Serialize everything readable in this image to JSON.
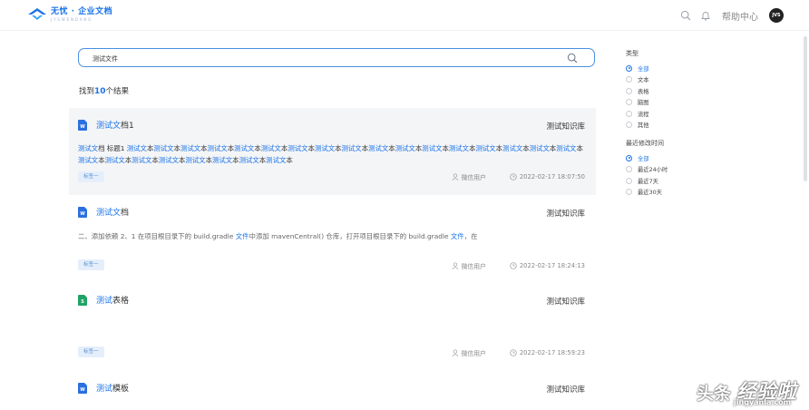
{
  "header": {
    "logo_title": "无忧 · 企业文档",
    "logo_subtitle": "J Y S W E N D A N G",
    "help_label": "帮助中心",
    "avatar_text": "JVS"
  },
  "search": {
    "value": "测试文件"
  },
  "results": {
    "prefix": "找到",
    "count": "10",
    "suffix": "个结果"
  },
  "cards": [
    {
      "title_hl": "测试文",
      "title_rest": "档1",
      "library": "测试知识库",
      "snippet_segments": [
        {
          "t": "测试文",
          "hl": true
        },
        {
          "t": "档 标题1 ",
          "hl": false
        },
        {
          "t": "测试文",
          "hl": true
        },
        {
          "t": "本",
          "hl": false
        },
        {
          "t": "测试文",
          "hl": true
        },
        {
          "t": "本",
          "hl": false
        },
        {
          "t": "测试文",
          "hl": true
        },
        {
          "t": "本",
          "hl": false
        },
        {
          "t": "测试文",
          "hl": true
        },
        {
          "t": "本",
          "hl": false
        },
        {
          "t": "测试文",
          "hl": true
        },
        {
          "t": "本",
          "hl": false
        },
        {
          "t": "测试文",
          "hl": true
        },
        {
          "t": "本",
          "hl": false
        },
        {
          "t": "测试文",
          "hl": true
        },
        {
          "t": "本",
          "hl": false
        },
        {
          "t": "测试文",
          "hl": true
        },
        {
          "t": "本",
          "hl": false
        },
        {
          "t": "测试文",
          "hl": true
        },
        {
          "t": "本",
          "hl": false
        },
        {
          "t": "测试文",
          "hl": true
        },
        {
          "t": "本",
          "hl": false
        },
        {
          "t": "测试文",
          "hl": true
        },
        {
          "t": "本",
          "hl": false
        },
        {
          "t": "测试文",
          "hl": true
        },
        {
          "t": "本",
          "hl": false
        },
        {
          "t": "测试文",
          "hl": true
        },
        {
          "t": "本",
          "hl": false
        },
        {
          "t": "测试文",
          "hl": true
        },
        {
          "t": "本",
          "hl": false
        },
        {
          "t": "测试文",
          "hl": true
        },
        {
          "t": "本",
          "hl": false
        },
        {
          "t": "测试文",
          "hl": true
        },
        {
          "t": "本",
          "hl": false
        },
        {
          "t": "测试文",
          "hl": true
        },
        {
          "t": "本",
          "hl": false
        },
        {
          "t": "测",
          "hl": true
        },
        {
          "t": "试文",
          "hl": true
        },
        {
          "t": "本",
          "hl": false
        },
        {
          "t": "测试文",
          "hl": true
        },
        {
          "t": "本",
          "hl": false
        },
        {
          "t": "测试文",
          "hl": true
        },
        {
          "t": "本",
          "hl": false
        },
        {
          "t": "测试文",
          "hl": true
        },
        {
          "t": "本",
          "hl": false
        },
        {
          "t": "测试文",
          "hl": true
        },
        {
          "t": "本",
          "hl": false
        },
        {
          "t": "测试文",
          "hl": true
        },
        {
          "t": "本",
          "hl": false
        },
        {
          "t": "测试文",
          "hl": true
        },
        {
          "t": "本",
          "hl": false
        },
        {
          "t": "测试文",
          "hl": true
        },
        {
          "t": "本",
          "hl": false
        }
      ],
      "tag": "标签一",
      "user": "微信用户",
      "time": "2022-02-17 18:07:50"
    },
    {
      "title_hl": "测试文",
      "title_rest": "档",
      "library": "测试知识库",
      "snippet_segments": [
        {
          "t": "二、添加依赖 2、1 在项目根目录下的 build.gradle ",
          "hl": false
        },
        {
          "t": "文件",
          "hl": true
        },
        {
          "t": "中添加 mavenCentral() 仓库，打开项目根目录下的 build.gradle ",
          "hl": false
        },
        {
          "t": "文件",
          "hl": true
        },
        {
          "t": "，在",
          "hl": false
        }
      ],
      "tag": "标签一",
      "user": "微信用户",
      "time": "2022-02-17 18:24:13"
    },
    {
      "title_hl": "测试",
      "title_rest": "表格",
      "library": "测试知识库",
      "snippet_segments": [],
      "tag": "标签一",
      "user": "微信用户",
      "time": "2022-02-17 18:59:23"
    },
    {
      "title_hl": "测试",
      "title_rest": "模板",
      "library": "测试知识库",
      "snippet_segments": [],
      "tag": "",
      "user": "",
      "time": ""
    }
  ],
  "filters": {
    "type_heading": "类型",
    "type_options": [
      {
        "label": "全部",
        "selected": true
      },
      {
        "label": "文本",
        "selected": false
      },
      {
        "label": "表格",
        "selected": false
      },
      {
        "label": "脑图",
        "selected": false
      },
      {
        "label": "流程",
        "selected": false
      },
      {
        "label": "其他",
        "selected": false
      }
    ],
    "time_heading": "最近修改时间",
    "time_options": [
      {
        "label": "全部",
        "selected": true
      },
      {
        "label": "最近24小时",
        "selected": false
      },
      {
        "label": "最近7天",
        "selected": false
      },
      {
        "label": "最近30天",
        "selected": false
      }
    ]
  },
  "watermark": {
    "left": "头条",
    "right": "经验啦",
    "url": "jingyanla.com"
  },
  "colors": {
    "accent": "#1a73e8",
    "card_highlight": "#f4f5f7",
    "word_icon": "#2b6fe0",
    "sheet_icon": "#21a366"
  }
}
